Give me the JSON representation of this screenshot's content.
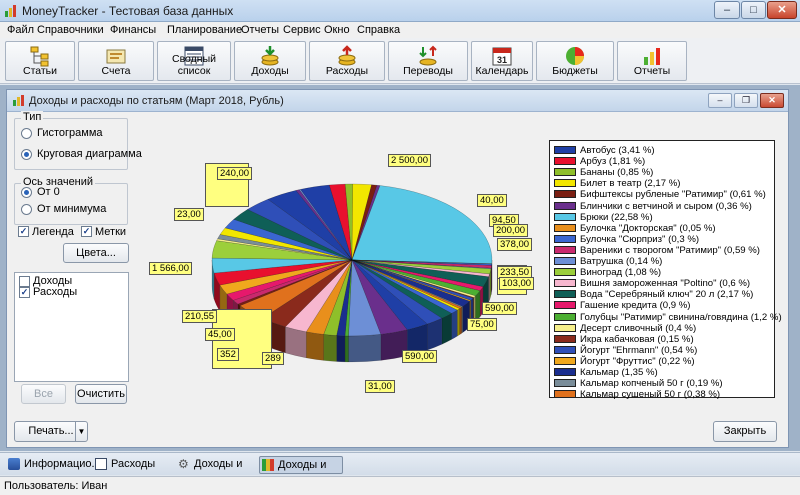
{
  "window": {
    "title": "MoneyTracker - Тестовая база данных",
    "min": "–",
    "max": "□",
    "close": "✕"
  },
  "menu": [
    "Файл",
    "Справочники",
    "Финансы",
    "Планирование",
    "Отчеты",
    "Сервис",
    "Окно",
    "Справка"
  ],
  "toolbar": [
    {
      "label": "Статьи",
      "icon": "tree-structure-icon"
    },
    {
      "label": "Счета",
      "icon": "wallet-icon"
    },
    {
      "label": "Сводный список",
      "icon": "list-icon"
    },
    {
      "label": "Доходы",
      "icon": "coins-income-icon"
    },
    {
      "label": "Расходы",
      "icon": "coins-expense-icon"
    },
    {
      "label": "Переводы",
      "icon": "transfer-icon"
    },
    {
      "label": "Календарь",
      "icon": "calendar-icon"
    },
    {
      "label": "Бюджеты",
      "icon": "pie-budget-icon"
    },
    {
      "label": "Отчеты",
      "icon": "bar-report-icon"
    }
  ],
  "calendar_day": "31",
  "report": {
    "title": "Доходы и расходы по статьям (Март 2018, Рубль)",
    "type_group": "Тип",
    "type_options": [
      "Гистограмма",
      "Круговая диаграмма"
    ],
    "type_selected": 1,
    "axis_group": "Ось значений",
    "axis_options": [
      "От 0",
      "От минимума"
    ],
    "axis_selected": 0,
    "legend_label": "Легенда",
    "legend_checked": true,
    "marks_label": "Метки",
    "marks_checked": true,
    "colors_button": "Цвета...",
    "list_items": [
      {
        "label": "Доходы",
        "checked": false
      },
      {
        "label": "Расходы",
        "checked": true
      }
    ],
    "all_button": "Все",
    "clear_button": "Очистить",
    "print_button": "Печать...",
    "close_button": "Закрыть"
  },
  "chart_data": {
    "type": "pie",
    "title": "",
    "legend": [
      {
        "label": "Автобус (3,41 %)",
        "color": "#1f3fa6"
      },
      {
        "label": "Арбуз (1,81 %)",
        "color": "#e8102e"
      },
      {
        "label": "Бананы (0,85 %)",
        "color": "#8fbf2a"
      },
      {
        "label": "Билет в театр (2,17 %)",
        "color": "#f2e600"
      },
      {
        "label": "Бифштексы рубленые \"Ратимир\" (0,61 %)",
        "color": "#7a1e12"
      },
      {
        "label": "Блинчики с ветчиной и сыром (0,36 %)",
        "color": "#6a2f8c"
      },
      {
        "label": "Брюки (22,58 %)",
        "color": "#58c8e6"
      },
      {
        "label": "Булочка \"Докторская\" (0,05 %)",
        "color": "#e98f1c"
      },
      {
        "label": "Булочка \"Сюрприз\" (0,3 %)",
        "color": "#3a66d1"
      },
      {
        "label": "Вареники с творогом \"Ратимир\" (0,59 %)",
        "color": "#c9296d"
      },
      {
        "label": "Ватрушка (0,14 %)",
        "color": "#6d8fd6"
      },
      {
        "label": "Виноград (1,08 %)",
        "color": "#9ccf3b"
      },
      {
        "label": "Вишня замороженная \"Poltino\" (0,6 %)",
        "color": "#f7b7cf"
      },
      {
        "label": "Вода \"Серебряный ключ\" 20 л (2,17 %)",
        "color": "#0f5f57"
      },
      {
        "label": "Гашение кредита (0,9 %)",
        "color": "#e6196c"
      },
      {
        "label": "Голубцы \"Ратимир\" свинина/говядина (1,2 %)",
        "color": "#4caf32"
      },
      {
        "label": "Десерт сливочный (0,4 %)",
        "color": "#f6ef8a"
      },
      {
        "label": "Икра кабачковая (0,15 %)",
        "color": "#8a2a1c"
      },
      {
        "label": "Йогурт \"Ehrmann\" (0,54 %)",
        "color": "#2f4fb8"
      },
      {
        "label": "Йогурт \"Фруттис\" (0,22 %)",
        "color": "#f0a81d"
      },
      {
        "label": "Кальмар (1,35 %)",
        "color": "#1a2e8f"
      },
      {
        "label": "Кальмар копченый 50 г (0,19 %)",
        "color": "#7a8d99"
      },
      {
        "label": "Кальмар сушеный 50 г (0,38 %)",
        "color": "#e0711d"
      }
    ],
    "labels": [
      "2 500,00",
      "1 566,00",
      "40,00",
      "94,50",
      "200,00",
      "378,00",
      "233,50",
      "103,00",
      "590,00",
      "75,00",
      "590,00",
      "31,00",
      "23,00",
      "210,55",
      "45,00",
      "289",
      "352",
      "240,00"
    ]
  },
  "tasks": [
    {
      "label": "Информацио...",
      "icon": "info-icon"
    },
    {
      "label": "Расходы",
      "icon": "table-icon"
    },
    {
      "label": "Доходы и р...",
      "icon": "gear-icon"
    },
    {
      "label": "Доходы и р...",
      "icon": "chart-icon"
    }
  ],
  "active_task": 3,
  "status": "Пользователь: Иван"
}
